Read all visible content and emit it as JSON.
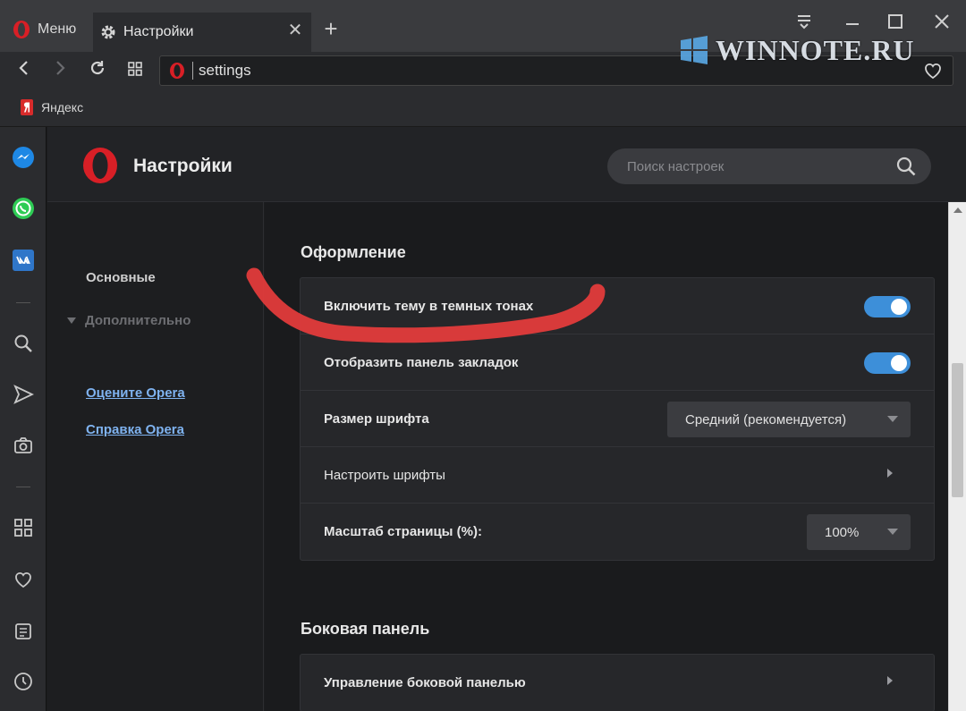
{
  "browser": {
    "menu_tab_label": "Меню",
    "active_tab_label": "Настройки",
    "tab_close_glyph": "✕",
    "new_tab_glyph": "+",
    "url": "settings",
    "bookmark": "Яндекс",
    "watermark": "WINNOTE.RU"
  },
  "header": {
    "title": "Настройки",
    "search_placeholder": "Поиск настроек"
  },
  "leftnav": {
    "basic": "Основные",
    "advanced": "Дополнительно",
    "rate_link": "Оцените Opera",
    "help_link": "Справка Opera"
  },
  "appearance": {
    "title": "Оформление",
    "dark_theme_label": "Включить тему в темных тонах",
    "dark_theme_on": true,
    "bookmarks_bar_label": "Отобразить панель закладок",
    "bookmarks_bar_on": true,
    "font_size_label": "Размер шрифта",
    "font_size_value": "Средний (рекомендуется)",
    "customize_fonts_label": "Настроить шрифты",
    "page_zoom_label": "Масштаб страницы (%):",
    "page_zoom_value": "100%"
  },
  "sidebar_section": {
    "title": "Боковая панель",
    "manage_label": "Управление боковой панелью"
  },
  "colors": {
    "accent": "#3d8fd9",
    "opera_red": "#d81f26",
    "marker_red": "#e23b3b"
  }
}
